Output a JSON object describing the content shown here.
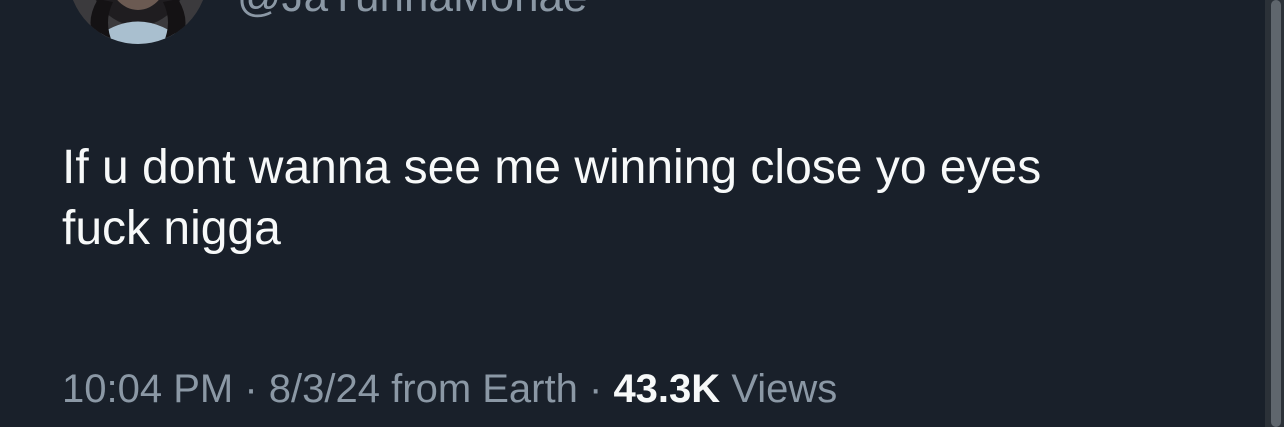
{
  "tweet": {
    "handle": "@JaYunnaMonae",
    "text_lines": [
      "If u dont wanna see me winning close yo eyes",
      "fuck nigga"
    ],
    "time": "10:04 PM",
    "separator": "·",
    "date": "8/3/24",
    "source": "from Earth",
    "views_count": "43.3K",
    "views_label": "Views",
    "avatar_icon": "profile-avatar"
  },
  "colors": {
    "background": "#19202a",
    "text_primary": "#f7f9f9",
    "text_secondary": "#8b98a5"
  }
}
